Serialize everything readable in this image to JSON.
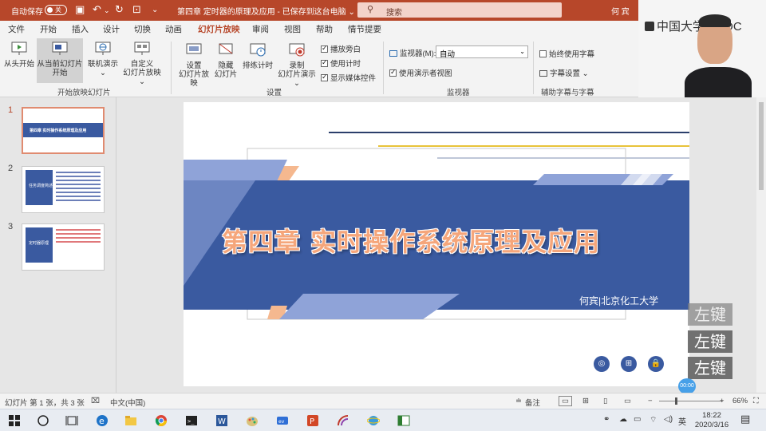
{
  "titlebar": {
    "autosave_label": "自动保存",
    "autosave_state": "关",
    "document_title": "第四章 定时器的原理及应用 - 已保存到这台电脑 ⌄",
    "search_placeholder": "搜索",
    "user_name": "何 宾",
    "accent_color": "#b7472a"
  },
  "mooc_overlay": {
    "brand": "中国大学MOOC"
  },
  "tabs": [
    "文件",
    "开始",
    "插入",
    "设计",
    "切换",
    "动画",
    "幻灯片放映",
    "审阅",
    "视图",
    "帮助",
    "情节提要"
  ],
  "active_tab": "幻灯片放映",
  "ribbon": {
    "start_group": {
      "label": "开始放映幻灯片",
      "from_beginning": "从头开始",
      "from_current_1": "从当前幻灯片",
      "from_current_2": "开始",
      "online_1": "联机演示",
      "online_2": "⌄",
      "custom_1": "自定义",
      "custom_2": "幻灯片放映 ⌄"
    },
    "setup_group": {
      "label": "设置",
      "setup_1": "设置",
      "setup_2": "幻灯片放映",
      "hide_1": "隐藏",
      "hide_2": "幻灯片",
      "rehearse": "排练计时",
      "record_1": "录制",
      "record_2": "幻灯片演示 ⌄",
      "play_narrations": "播放旁白",
      "use_timings": "使用计时",
      "show_media_controls": "显示媒体控件"
    },
    "monitors_group": {
      "label": "监视器",
      "monitor_label": "监视器(M):",
      "monitor_value": "自动",
      "presenter_view": "使用演示者视图"
    },
    "captions_group": {
      "label": "辅助字幕与字幕",
      "always_use_subtitles": "始终使用字幕",
      "subtitle_settings": "字幕设置 ⌄"
    }
  },
  "slides_pane": {
    "thumbnails": [
      {
        "number": "1",
        "title": "第四章  实时操作系统原理及应用"
      },
      {
        "number": "2",
        "title": "任务调度简述"
      },
      {
        "number": "3",
        "title": "定时器原理"
      }
    ]
  },
  "slide": {
    "title": "第四章  实时操作系统原理及应用",
    "author": "何宾|北京化工大学",
    "accent_blue": "#3a5aa0",
    "accent_orange": "#f5a67b"
  },
  "key_overlays": [
    "左键",
    "左键",
    "左键"
  ],
  "timer_badge": "00:00",
  "statusbar": {
    "slide_info": "幻灯片 第 1 张，共 3 张",
    "language": "中文(中国)",
    "notes": "备注",
    "zoom": "66%"
  },
  "taskbar": {
    "ime": "英",
    "time": "18:22",
    "date": "2020/3/16"
  }
}
